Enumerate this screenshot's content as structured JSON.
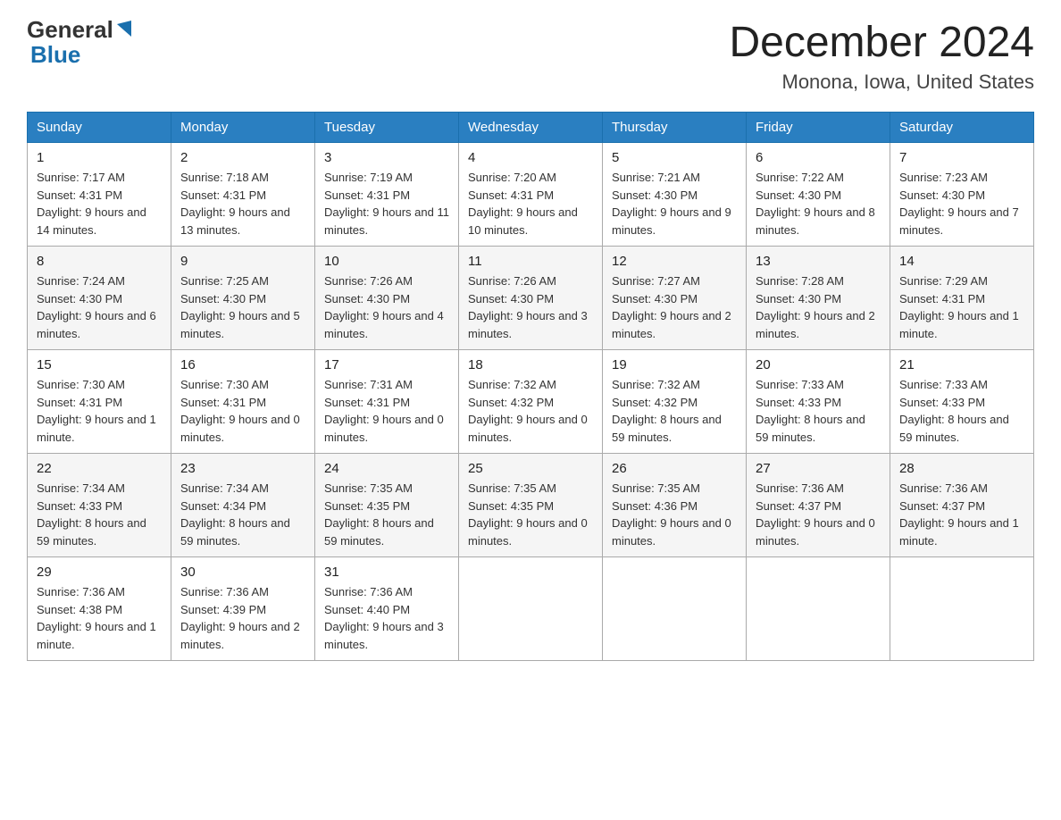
{
  "header": {
    "logo_general": "General",
    "logo_blue": "Blue",
    "month_title": "December 2024",
    "location": "Monona, Iowa, United States"
  },
  "days_of_week": [
    "Sunday",
    "Monday",
    "Tuesday",
    "Wednesday",
    "Thursday",
    "Friday",
    "Saturday"
  ],
  "weeks": [
    [
      {
        "day": "1",
        "sunrise": "7:17 AM",
        "sunset": "4:31 PM",
        "daylight": "9 hours and 14 minutes."
      },
      {
        "day": "2",
        "sunrise": "7:18 AM",
        "sunset": "4:31 PM",
        "daylight": "9 hours and 13 minutes."
      },
      {
        "day": "3",
        "sunrise": "7:19 AM",
        "sunset": "4:31 PM",
        "daylight": "9 hours and 11 minutes."
      },
      {
        "day": "4",
        "sunrise": "7:20 AM",
        "sunset": "4:31 PM",
        "daylight": "9 hours and 10 minutes."
      },
      {
        "day": "5",
        "sunrise": "7:21 AM",
        "sunset": "4:30 PM",
        "daylight": "9 hours and 9 minutes."
      },
      {
        "day": "6",
        "sunrise": "7:22 AM",
        "sunset": "4:30 PM",
        "daylight": "9 hours and 8 minutes."
      },
      {
        "day": "7",
        "sunrise": "7:23 AM",
        "sunset": "4:30 PM",
        "daylight": "9 hours and 7 minutes."
      }
    ],
    [
      {
        "day": "8",
        "sunrise": "7:24 AM",
        "sunset": "4:30 PM",
        "daylight": "9 hours and 6 minutes."
      },
      {
        "day": "9",
        "sunrise": "7:25 AM",
        "sunset": "4:30 PM",
        "daylight": "9 hours and 5 minutes."
      },
      {
        "day": "10",
        "sunrise": "7:26 AM",
        "sunset": "4:30 PM",
        "daylight": "9 hours and 4 minutes."
      },
      {
        "day": "11",
        "sunrise": "7:26 AM",
        "sunset": "4:30 PM",
        "daylight": "9 hours and 3 minutes."
      },
      {
        "day": "12",
        "sunrise": "7:27 AM",
        "sunset": "4:30 PM",
        "daylight": "9 hours and 2 minutes."
      },
      {
        "day": "13",
        "sunrise": "7:28 AM",
        "sunset": "4:30 PM",
        "daylight": "9 hours and 2 minutes."
      },
      {
        "day": "14",
        "sunrise": "7:29 AM",
        "sunset": "4:31 PM",
        "daylight": "9 hours and 1 minute."
      }
    ],
    [
      {
        "day": "15",
        "sunrise": "7:30 AM",
        "sunset": "4:31 PM",
        "daylight": "9 hours and 1 minute."
      },
      {
        "day": "16",
        "sunrise": "7:30 AM",
        "sunset": "4:31 PM",
        "daylight": "9 hours and 0 minutes."
      },
      {
        "day": "17",
        "sunrise": "7:31 AM",
        "sunset": "4:31 PM",
        "daylight": "9 hours and 0 minutes."
      },
      {
        "day": "18",
        "sunrise": "7:32 AM",
        "sunset": "4:32 PM",
        "daylight": "9 hours and 0 minutes."
      },
      {
        "day": "19",
        "sunrise": "7:32 AM",
        "sunset": "4:32 PM",
        "daylight": "8 hours and 59 minutes."
      },
      {
        "day": "20",
        "sunrise": "7:33 AM",
        "sunset": "4:33 PM",
        "daylight": "8 hours and 59 minutes."
      },
      {
        "day": "21",
        "sunrise": "7:33 AM",
        "sunset": "4:33 PM",
        "daylight": "8 hours and 59 minutes."
      }
    ],
    [
      {
        "day": "22",
        "sunrise": "7:34 AM",
        "sunset": "4:33 PM",
        "daylight": "8 hours and 59 minutes."
      },
      {
        "day": "23",
        "sunrise": "7:34 AM",
        "sunset": "4:34 PM",
        "daylight": "8 hours and 59 minutes."
      },
      {
        "day": "24",
        "sunrise": "7:35 AM",
        "sunset": "4:35 PM",
        "daylight": "8 hours and 59 minutes."
      },
      {
        "day": "25",
        "sunrise": "7:35 AM",
        "sunset": "4:35 PM",
        "daylight": "9 hours and 0 minutes."
      },
      {
        "day": "26",
        "sunrise": "7:35 AM",
        "sunset": "4:36 PM",
        "daylight": "9 hours and 0 minutes."
      },
      {
        "day": "27",
        "sunrise": "7:36 AM",
        "sunset": "4:37 PM",
        "daylight": "9 hours and 0 minutes."
      },
      {
        "day": "28",
        "sunrise": "7:36 AM",
        "sunset": "4:37 PM",
        "daylight": "9 hours and 1 minute."
      }
    ],
    [
      {
        "day": "29",
        "sunrise": "7:36 AM",
        "sunset": "4:38 PM",
        "daylight": "9 hours and 1 minute."
      },
      {
        "day": "30",
        "sunrise": "7:36 AM",
        "sunset": "4:39 PM",
        "daylight": "9 hours and 2 minutes."
      },
      {
        "day": "31",
        "sunrise": "7:36 AM",
        "sunset": "4:40 PM",
        "daylight": "9 hours and 3 minutes."
      },
      null,
      null,
      null,
      null
    ]
  ]
}
